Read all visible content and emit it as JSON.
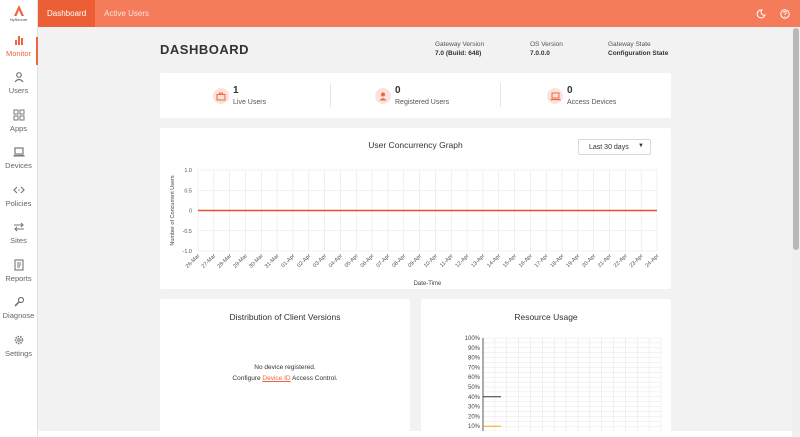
{
  "brand": {
    "name": "HySecure"
  },
  "sidebar": {
    "items": [
      {
        "label": "Monitor",
        "icon": "monitor-icon",
        "active": true
      },
      {
        "label": "Users",
        "icon": "users-icon"
      },
      {
        "label": "Apps",
        "icon": "apps-icon"
      },
      {
        "label": "Devices",
        "icon": "devices-icon"
      },
      {
        "label": "Policies",
        "icon": "policies-icon"
      },
      {
        "label": "Sites",
        "icon": "sites-icon"
      },
      {
        "label": "Reports",
        "icon": "reports-icon"
      },
      {
        "label": "Diagnose",
        "icon": "diagnose-icon"
      },
      {
        "label": "Settings",
        "icon": "settings-icon"
      }
    ]
  },
  "topbar": {
    "tabs": [
      {
        "label": "Dashboard",
        "active": true
      },
      {
        "label": "Active Users",
        "active": false
      }
    ],
    "icons": [
      "theme-toggle-icon",
      "help-icon"
    ]
  },
  "header": {
    "title": "DASHBOARD",
    "gateway_version_label": "Gateway Version",
    "gateway_version_value": "7.0 (Build: 648)",
    "os_version_label": "OS Version",
    "os_version_value": "7.0.0.0",
    "gateway_state_label": "Gateway State",
    "gateway_state_value": "Configuration State"
  },
  "stats": [
    {
      "value": "1",
      "label": "Live Users",
      "icon": "briefcase-icon"
    },
    {
      "value": "0",
      "label": "Registered Users",
      "icon": "user-icon"
    },
    {
      "value": "0",
      "label": "Access Devices",
      "icon": "laptop-icon"
    }
  ],
  "concurrency": {
    "title": "User Concurrency Graph",
    "range": "Last 30 days",
    "colors": {
      "line": "#e0522b",
      "grid": "#e6e6e6"
    }
  },
  "chart_data": [
    {
      "type": "line",
      "title": "User Concurrency Graph",
      "xlabel": "Date-Time",
      "ylabel": "Number of Concurrent Users",
      "ylim": [
        -1.0,
        1.0
      ],
      "yticks": [
        "1.0",
        "0.5",
        "0",
        "-0.5",
        "-1.0"
      ],
      "categories": [
        "26-Mar",
        "27-Mar",
        "28-Mar",
        "29-Mar",
        "30-Mar",
        "31-Mar",
        "01-Apr",
        "02-Apr",
        "03-Apr",
        "04-Apr",
        "05-Apr",
        "06-Apr",
        "07-Apr",
        "08-Apr",
        "09-Apr",
        "10-Apr",
        "11-Apr",
        "12-Apr",
        "13-Apr",
        "14-Apr",
        "15-Apr",
        "16-Apr",
        "17-Apr",
        "18-Apr",
        "19-Apr",
        "20-Apr",
        "21-Apr",
        "22-Apr",
        "23-Apr",
        "24-Apr"
      ],
      "values": [
        0,
        0,
        0,
        0,
        0,
        0,
        0,
        0,
        0,
        0,
        0,
        0,
        0,
        0,
        0,
        0,
        0,
        0,
        0,
        0,
        0,
        0,
        0,
        0,
        0,
        0,
        0,
        0,
        0,
        0
      ],
      "grid": true
    },
    {
      "type": "line",
      "title": "Resource Usage",
      "ylim": [
        0,
        100
      ],
      "yticks": [
        "100%",
        "90%",
        "80%",
        "70%",
        "60%",
        "50%",
        "40%",
        "30%",
        "20%",
        "10%"
      ],
      "series": [
        {
          "values": [
            40,
            40
          ],
          "color": "#333333"
        },
        {
          "values": [
            10,
            10
          ],
          "color": "#f0a30a"
        }
      ],
      "grid": true
    }
  ],
  "distribution": {
    "title": "Distribution of Client Versions",
    "empty_line1": "No device registered.",
    "empty_prefix": "Configure",
    "empty_link": "Device ID",
    "empty_suffix": "Access Control."
  },
  "resource": {
    "title": "Resource Usage"
  }
}
